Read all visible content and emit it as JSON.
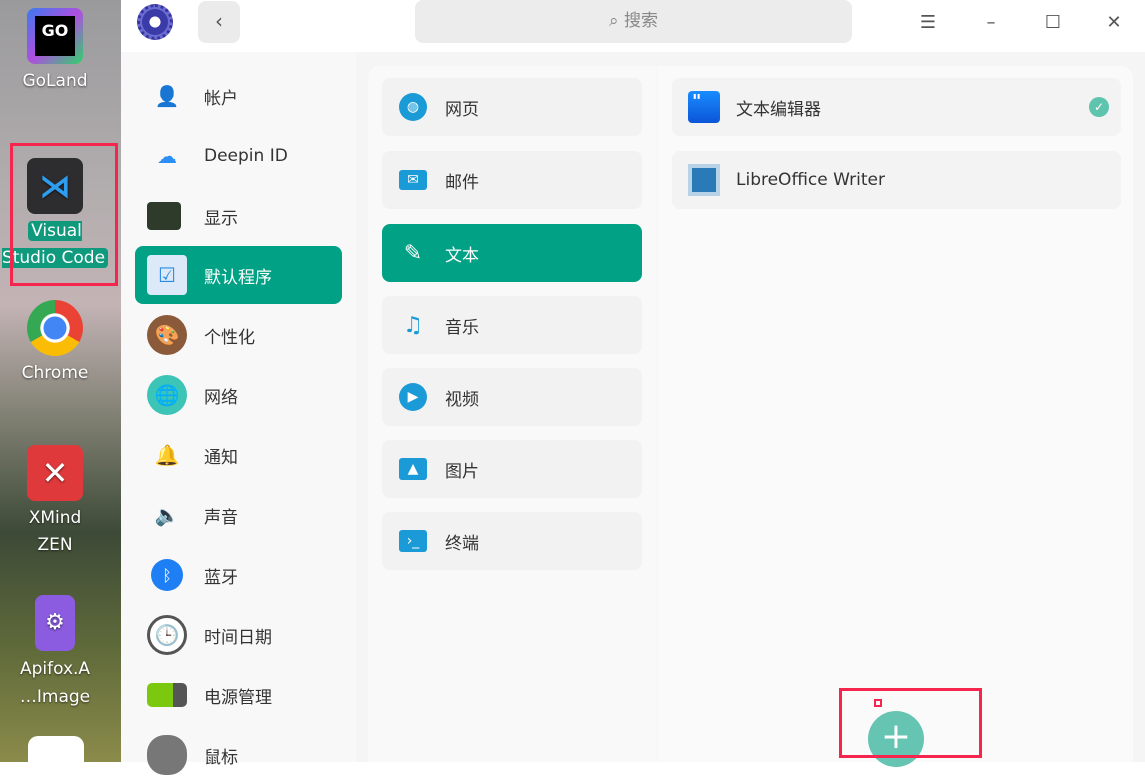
{
  "desktop": {
    "icons": [
      {
        "label": "GoLand",
        "name": "goland"
      },
      {
        "label": "Visual Studio Code",
        "name": "vscode",
        "selected": true
      },
      {
        "label": "Chrome",
        "name": "chrome"
      },
      {
        "label": "XMind ZEN",
        "name": "xmind"
      },
      {
        "label": "Apifox.A\n…Image",
        "name": "apifox"
      }
    ]
  },
  "titlebar": {
    "search_placeholder": "搜索"
  },
  "sidebar": {
    "items": [
      {
        "label": "帐户"
      },
      {
        "label": "Deepin ID"
      },
      {
        "label": "显示"
      },
      {
        "label": "默认程序",
        "active": true
      },
      {
        "label": "个性化"
      },
      {
        "label": "网络"
      },
      {
        "label": "通知"
      },
      {
        "label": "声音"
      },
      {
        "label": "蓝牙"
      },
      {
        "label": "时间日期"
      },
      {
        "label": "电源管理"
      },
      {
        "label": "鼠标"
      }
    ]
  },
  "categories": {
    "items": [
      {
        "label": "网页"
      },
      {
        "label": "邮件"
      },
      {
        "label": "文本",
        "active": true
      },
      {
        "label": "音乐"
      },
      {
        "label": "视频"
      },
      {
        "label": "图片"
      },
      {
        "label": "终端"
      }
    ]
  },
  "apps": {
    "items": [
      {
        "label": "文本编辑器",
        "default": true
      },
      {
        "label": "LibreOffice Writer"
      }
    ]
  },
  "colors": {
    "accent": "#00a184",
    "highlight": "#f5254d"
  }
}
